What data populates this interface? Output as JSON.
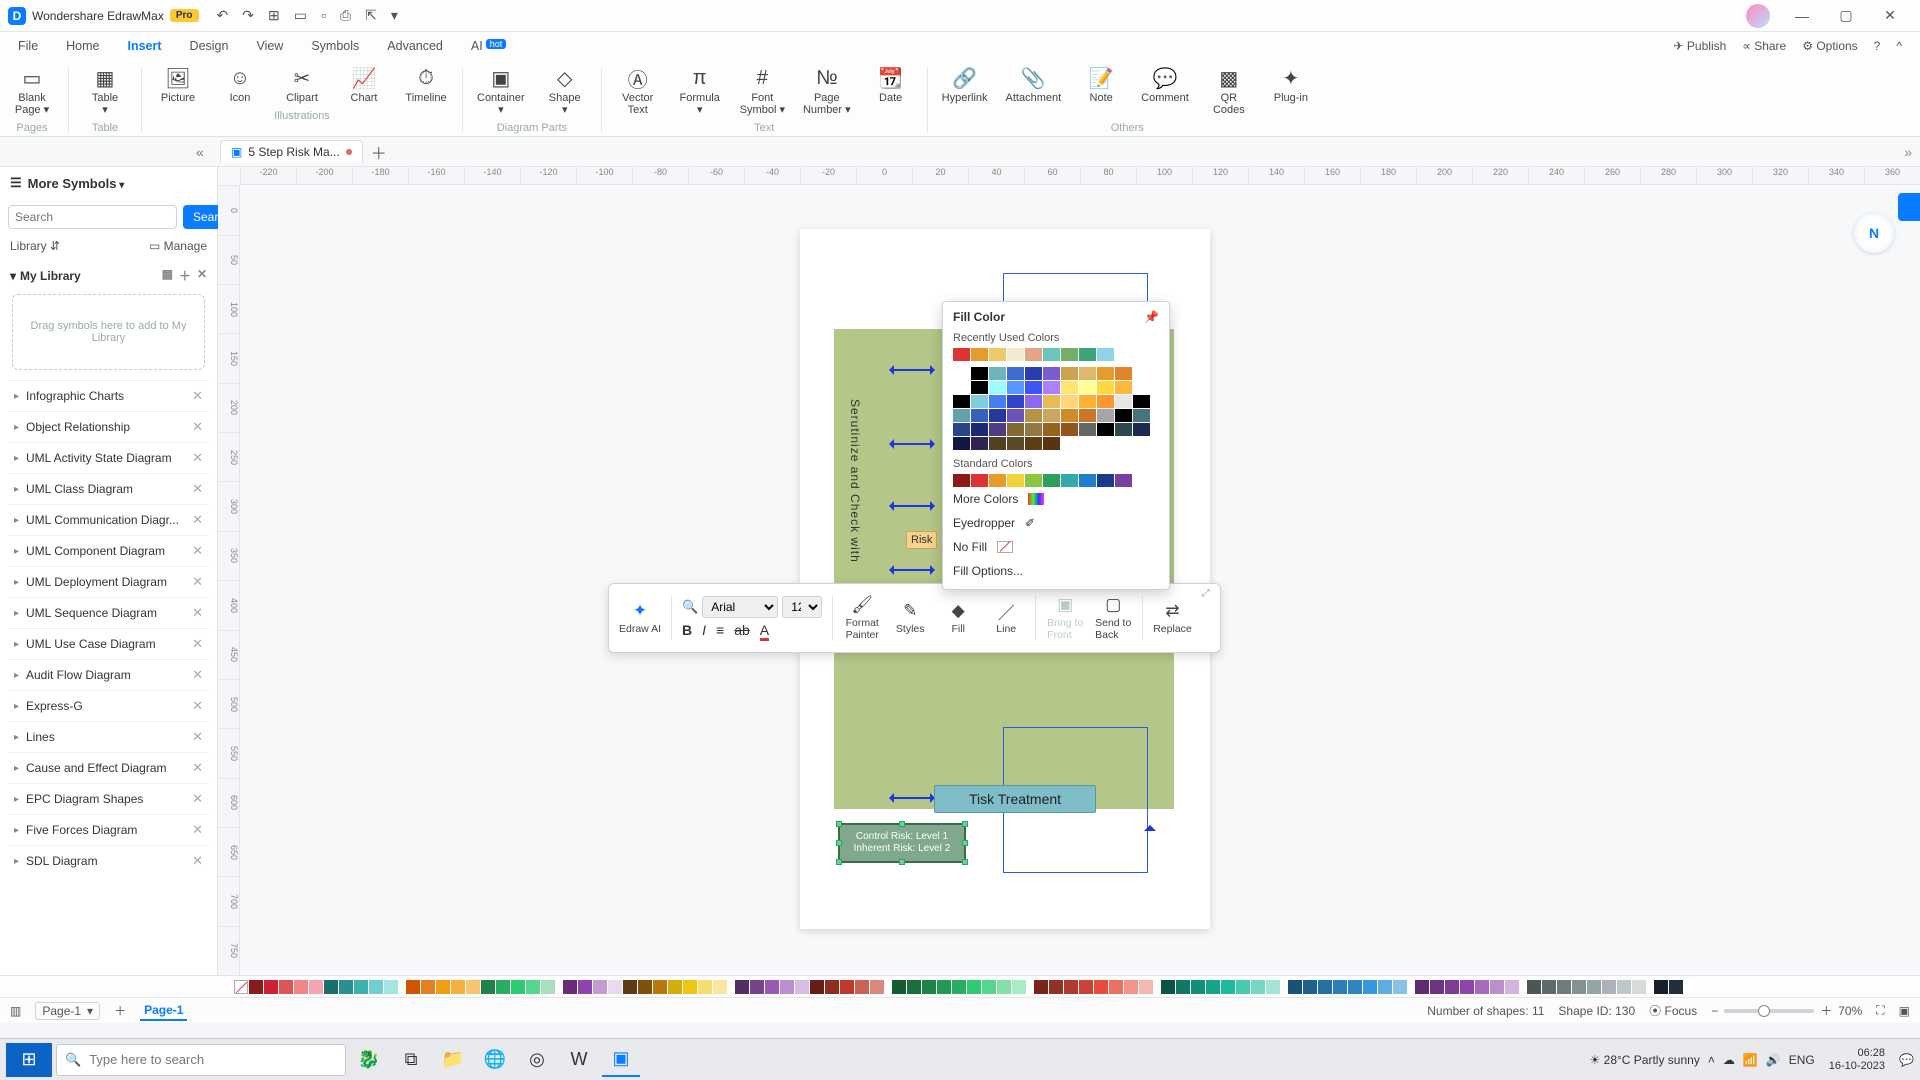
{
  "app": {
    "title": "Wondershare EdrawMax",
    "badge": "Pro"
  },
  "menu": {
    "items": [
      "File",
      "Home",
      "Insert",
      "Design",
      "View",
      "Symbols",
      "Advanced",
      "AI"
    ],
    "active": "Insert",
    "right": {
      "publish": "Publish",
      "share": "Share",
      "options": "Options"
    }
  },
  "ribbon": {
    "groups": {
      "pages": {
        "label": "Pages",
        "tools": [
          {
            "icon": "▭",
            "label": "Blank\nPage ▾"
          }
        ]
      },
      "table": {
        "label": "Table",
        "tools": [
          {
            "icon": "▦",
            "label": "Table\n▾"
          }
        ]
      },
      "illustrations": {
        "label": "Illustrations",
        "tools": [
          {
            "icon": "🖼",
            "label": "Picture"
          },
          {
            "icon": "☺",
            "label": "Icon"
          },
          {
            "icon": "✂",
            "label": "Clipart"
          },
          {
            "icon": "📈",
            "label": "Chart"
          },
          {
            "icon": "⏱",
            "label": "Timeline"
          }
        ]
      },
      "diagramparts": {
        "label": "Diagram Parts",
        "tools": [
          {
            "icon": "▣",
            "label": "Container\n▾"
          },
          {
            "icon": "◇",
            "label": "Shape\n▾"
          }
        ]
      },
      "text": {
        "label": "Text",
        "tools": [
          {
            "icon": "Ⓐ",
            "label": "Vector\nText"
          },
          {
            "icon": "π",
            "label": "Formula\n▾"
          },
          {
            "icon": "#",
            "label": "Font\nSymbol ▾"
          },
          {
            "icon": "№",
            "label": "Page\nNumber ▾"
          },
          {
            "icon": "📆",
            "label": "Date"
          }
        ]
      },
      "others": {
        "label": "Others",
        "tools": [
          {
            "icon": "🔗",
            "label": "Hyperlink"
          },
          {
            "icon": "📎",
            "label": "Attachment"
          },
          {
            "icon": "📝",
            "label": "Note"
          },
          {
            "icon": "💬",
            "label": "Comment"
          },
          {
            "icon": "▩",
            "label": "QR\nCodes"
          },
          {
            "icon": "✦",
            "label": "Plug-in"
          }
        ]
      }
    }
  },
  "doc": {
    "tab_name": "5 Step Risk Ma...",
    "modified": true
  },
  "left": {
    "title": "More Symbols",
    "search_placeholder": "Search",
    "search_btn": "Search",
    "library_lbl": "Library",
    "manage_lbl": "Manage",
    "mylib": "My Library",
    "dropbox": "Drag symbols here to add to My Library",
    "items": [
      "Infographic Charts",
      "Object Relationship",
      "UML Activity State Diagram",
      "UML Class Diagram",
      "UML Communication Diagr...",
      "UML Component Diagram",
      "UML Deployment Diagram",
      "UML Sequence Diagram",
      "UML Use Case Diagram",
      "Audit Flow Diagram",
      "Express-G",
      "Lines",
      "Cause and Effect Diagram",
      "EPC Diagram Shapes",
      "Five Forces Diagram",
      "SDL Diagram"
    ]
  },
  "ruler_h": [
    "-220",
    "-200",
    "-180",
    "-160",
    "-140",
    "-120",
    "-100",
    "-80",
    "-60",
    "-40",
    "-20",
    "0",
    "20",
    "40",
    "60",
    "80",
    "100",
    "120",
    "140",
    "160",
    "180",
    "200",
    "220",
    "240",
    "260",
    "280",
    "300",
    "320",
    "340",
    "360"
  ],
  "ruler_v": [
    "0",
    "50",
    "100",
    "150",
    "200",
    "250",
    "300",
    "350",
    "400",
    "450",
    "500",
    "550",
    "600",
    "650",
    "700",
    "750"
  ],
  "canvas": {
    "vertical_text": "Serutinize and Check with",
    "risk_label": "Risk",
    "proc_label": "Tisk Treatment",
    "ctrl_line1": "Control Risk: Level 1",
    "ctrl_line2": "Inherent Risk: Level 2"
  },
  "fill_popup": {
    "title": "Fill Color",
    "recent_lbl": "Recently Used Colors",
    "recent": [
      "#d33",
      "#e69b2b",
      "#f0c96b",
      "#f3ead2",
      "#e7a385",
      "#69c6b8",
      "#72b06a",
      "#3fa37a",
      "#8fd3e8"
    ],
    "theme_row": [
      "#ffffff",
      "#000000",
      "#6fb3bd",
      "#3e6cd3",
      "#2a3db0",
      "#7a5bd0",
      "#c9a34e",
      "#e0b86a",
      "#e79a2d",
      "#e0832a"
    ],
    "std_lbl": "Standard Colors",
    "std": [
      "#8b1a1a",
      "#d33",
      "#e69b2b",
      "#f2d23a",
      "#8cc63f",
      "#2aa15a",
      "#34a8aa",
      "#1f7fcf",
      "#1b3b8b",
      "#7a3fa3"
    ],
    "more": "More Colors",
    "eyedrop": "Eyedropper",
    "nofill": "No Fill",
    "fillopt": "Fill Options..."
  },
  "float_tb": {
    "edraw_ai": "Edraw AI",
    "font": "Arial",
    "size": "12",
    "format_painter": "Format\nPainter",
    "styles": "Styles",
    "fill": "Fill",
    "line": "Line",
    "bring": "Bring to\nFront",
    "send": "Send to\nBack",
    "replace": "Replace"
  },
  "color_strip": [
    "#8b1a1a",
    "#c23",
    "#d55",
    "#e88",
    "#f4a6b0",
    "#1b6e6e",
    "#2a8f8f",
    "#3eb0b0",
    "#6fd0d0",
    "#a4e4e4",
    "",
    "#d35400",
    "#e67e22",
    "#f39c12",
    "#f5b041",
    "#f8c471",
    "#1e8449",
    "#27ae60",
    "#2ecc71",
    "#58d68d",
    "#a9dfbf",
    "",
    "#6b2b7a",
    "#8e44ad",
    "#c39bd3",
    "#e8daef",
    "#5c3b12",
    "#7e5109",
    "#b9770e",
    "#d4ac0d",
    "#f1c40f",
    "#f7dc6f",
    "#f9e79f",
    "",
    "#512e5f",
    "#76448a",
    "#9b59b6",
    "#bb8fce",
    "#d7bde2",
    "#641e16",
    "#922b21",
    "#c0392b",
    "#cd6155",
    "#d98880",
    "",
    "#145a32",
    "#196f3d",
    "#1e8449",
    "#229954",
    "#27ae60",
    "#2ecc71",
    "#58d68d",
    "#82e0aa",
    "#abebc6",
    "",
    "#7b241c",
    "#943126",
    "#b03a2e",
    "#cb4335",
    "#e74c3c",
    "#ec7063",
    "#f1948a",
    "#f5b7b1",
    "",
    "#0b5345",
    "#117864",
    "#148f77",
    "#17a589",
    "#1abc9c",
    "#48c9b0",
    "#76d7c4",
    "#a3e4d7",
    "",
    "#1a5276",
    "#1f618d",
    "#2471a3",
    "#2980b9",
    "#2e86c1",
    "#3498db",
    "#5dade2",
    "#85c1e9",
    "",
    "#5b2c6f",
    "#6c3483",
    "#7d3c98",
    "#8e44ad",
    "#a569bd",
    "#bb8fce",
    "#d2b4de",
    "",
    "#4d5656",
    "#616a6b",
    "#707b7c",
    "#839192",
    "#95a5a6",
    "#abb2b9",
    "#bfc9ca",
    "#d5dbdb",
    "",
    "#17202a",
    "#212f3d",
    "#ffffff"
  ],
  "status": {
    "page_sel": "Page-1",
    "page_tab": "Page-1",
    "shapes": "Number of shapes: 11",
    "shapeid": "Shape ID: 130",
    "focus": "Focus",
    "zoom": "70%"
  },
  "taskbar": {
    "search_ph": "Type here to search",
    "weather": "28°C  Partly sunny",
    "lang": "ENG",
    "time": "06:28",
    "date": "16-10-2023"
  }
}
